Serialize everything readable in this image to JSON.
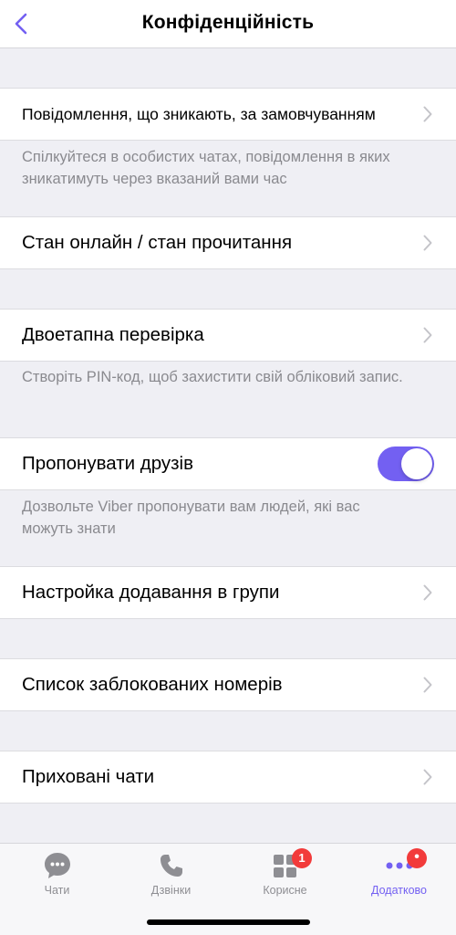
{
  "header": {
    "title": "Конфіденційність",
    "back_icon": "chevron-left-icon",
    "accent_color": "#7360f2"
  },
  "settings": {
    "disappearing": {
      "label": "Повідомлення, що зникають, за замовчуванням",
      "description": "Спілкуйтеся в особистих чатах, повідомлення в яких зникатимуть через вказаний вами час"
    },
    "online_status": {
      "label": "Стан онлайн / стан прочитання"
    },
    "two_step": {
      "label": "Двоетапна перевірка",
      "description": "Створіть PIN-код, щоб захистити свій обліковий запис."
    },
    "suggest_friends": {
      "label": "Пропонувати друзів",
      "enabled": true,
      "description": "Дозвольте Viber пропонувати вам людей, які вас можуть знати"
    },
    "group_add": {
      "label": "Настройка додавання в групи"
    },
    "blocked": {
      "label": "Список заблокованих номерів"
    },
    "hidden_chats": {
      "label": "Приховані чати"
    }
  },
  "tabbar": {
    "tabs": [
      {
        "label": "Чати",
        "icon": "chat-bubble-icon",
        "active": false
      },
      {
        "label": "Дзвінки",
        "icon": "phone-icon",
        "active": false
      },
      {
        "label": "Корисне",
        "icon": "apps-grid-icon",
        "badge": "1",
        "active": false
      },
      {
        "label": "Додатково",
        "icon": "more-dots-icon",
        "badge": "•",
        "active": true
      }
    ]
  }
}
